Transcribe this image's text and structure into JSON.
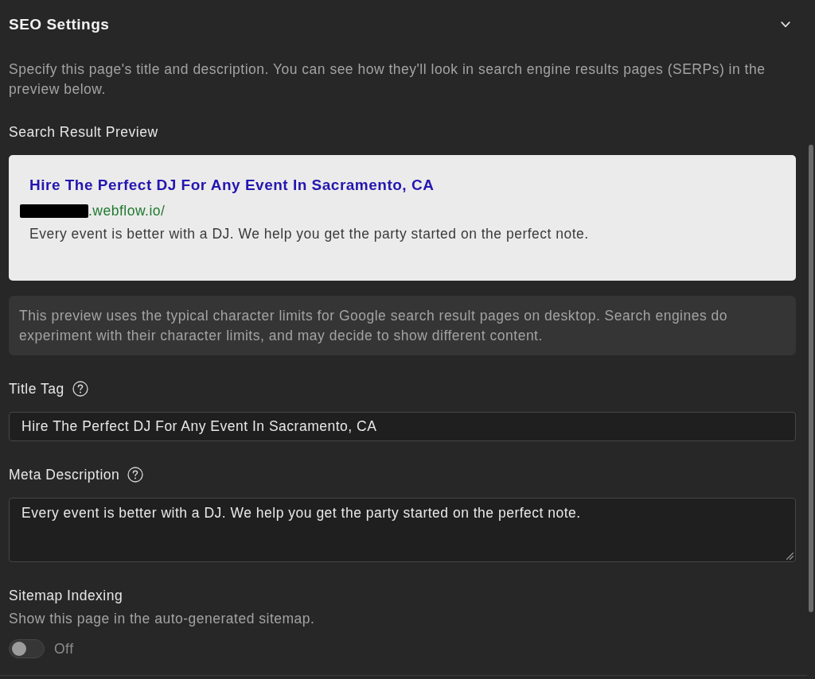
{
  "section": {
    "title": "SEO Settings",
    "expanded": true,
    "description": "Specify this page's title and description. You can see how they'll look in search engine results pages (SERPs) in the preview below."
  },
  "preview": {
    "label": "Search Result Preview",
    "title": "Hire The Perfect DJ For Any Event In Sacramento, CA",
    "url_redacted": true,
    "url": ".webflow.io/",
    "snippet": "Every event is better with a DJ. We help you get the party started on the perfect note."
  },
  "note": "This preview uses the typical character limits for Google search result pages on desktop. Search engines do experiment with their character limits, and may decide to show different content.",
  "fields": [
    {
      "kind": "input",
      "label": "Title Tag",
      "help": true,
      "value": "Hire The Perfect DJ For Any Event In Sacramento, CA"
    },
    {
      "kind": "textarea",
      "label": "Meta Description",
      "help": true,
      "value": "Every event is better with a DJ. We help you get the party started on the perfect note."
    }
  ],
  "sitemap": {
    "label": "Sitemap Indexing",
    "description": "Show this page in the auto-generated sitemap.",
    "on": false,
    "state_label": "Off"
  }
}
